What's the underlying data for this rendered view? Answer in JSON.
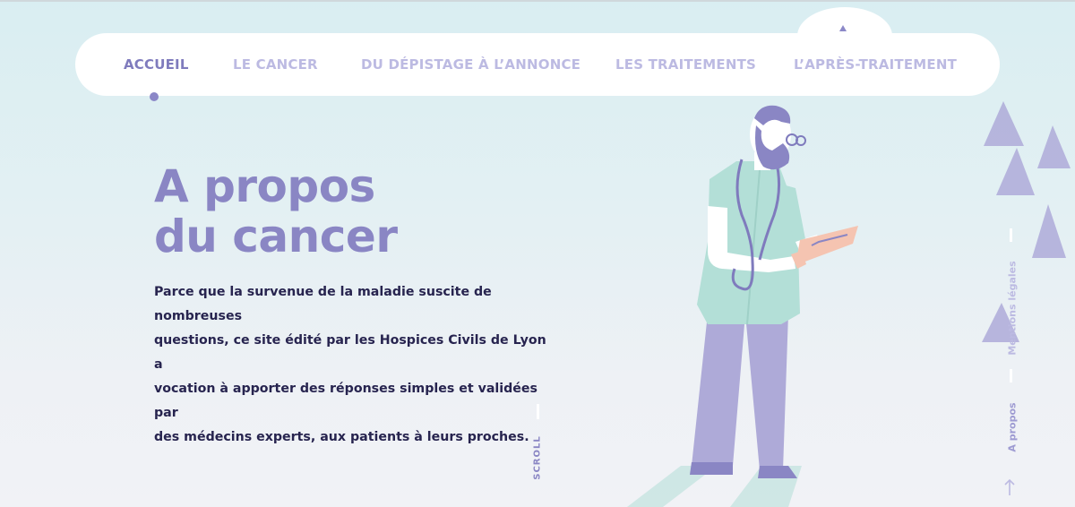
{
  "nav": {
    "items": [
      {
        "label": "ACCUEIL",
        "active": true
      },
      {
        "label": "LE CANCER",
        "active": false
      },
      {
        "label": "DU DÉPISTAGE À L’ANNONCE",
        "active": false
      },
      {
        "label": "LES TRAITEMENTS",
        "active": false
      },
      {
        "label": "L’APRÈS-TRAITEMENT",
        "active": false
      }
    ]
  },
  "hero": {
    "title_line1": "A propos",
    "title_line2": "du cancer",
    "lines": [
      "Parce que la survenue de la maladie suscite de nombreuses",
      "questions, ce site édité par les Hospices Civils de Lyon a",
      "vocation à apporter des réponses simples et validées par",
      "des médecins experts, aux patients à leurs proches."
    ]
  },
  "scroll": {
    "label": "SCROLL"
  },
  "side_nav": {
    "mentions_label": "Mentions légales",
    "apropos_label": "A propos"
  },
  "colors": {
    "accent": "#8a86c4",
    "accent_light": "#bcbae2",
    "text_dark": "#27244f",
    "coat": "#b3dfd7",
    "trousers": "#aeaad8",
    "skin": "#ffffff"
  },
  "icons": {
    "up_arrow": "arrow-up-icon",
    "nav_marker": "dot-icon"
  }
}
